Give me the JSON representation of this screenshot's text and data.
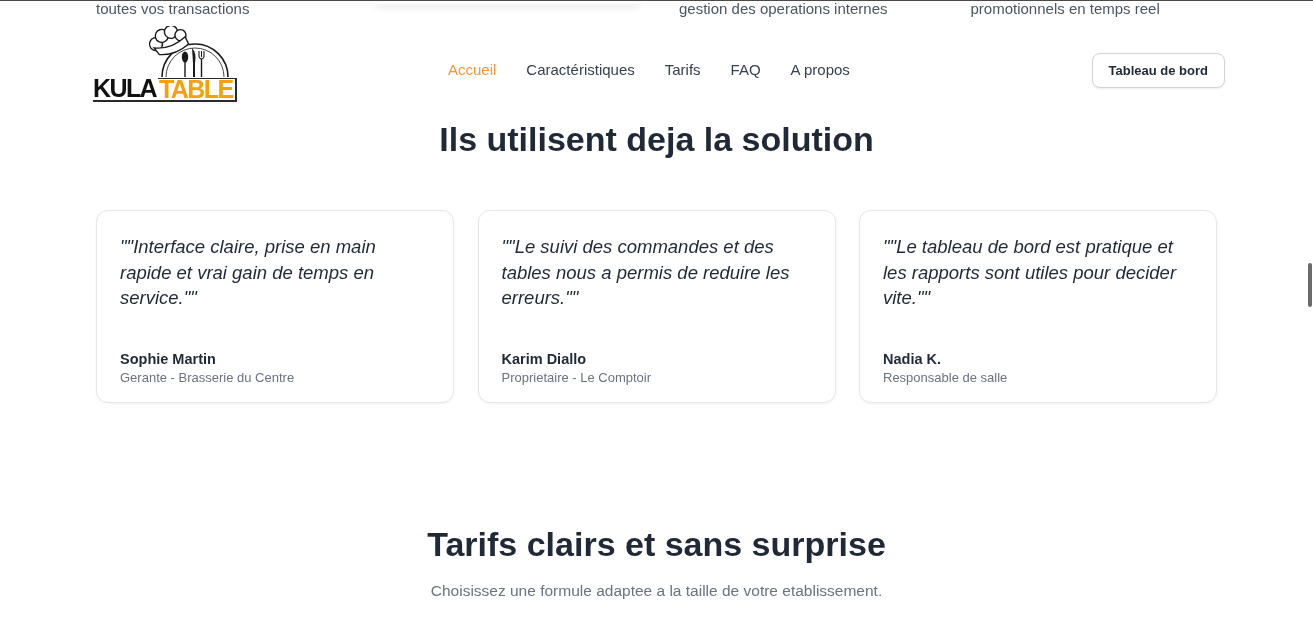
{
  "top_strip": [
    {
      "kind": "text",
      "text": "toutes vos transactions"
    },
    {
      "kind": "card"
    },
    {
      "kind": "text",
      "text": "gestion des operations internes"
    },
    {
      "kind": "text",
      "text": "promotionnels en temps reel"
    }
  ],
  "header": {
    "logo": {
      "dark": "KULA",
      "accent": "TABLE"
    },
    "nav": [
      {
        "label": "Accueil",
        "selected": true
      },
      {
        "label": "Caractéristiques",
        "selected": false
      },
      {
        "label": "Tarifs",
        "selected": false
      },
      {
        "label": "FAQ",
        "selected": false
      },
      {
        "label": "A propos",
        "selected": false
      }
    ],
    "dashboard_button": "Tableau de bord"
  },
  "testimonials": {
    "title": "Ils utilisent deja la solution",
    "cards": [
      {
        "quote": "\"\"Interface claire, prise en main rapide et vrai gain de temps en service.\"\"",
        "name": "Sophie Martin",
        "role": "Gerante - Brasserie du Centre"
      },
      {
        "quote": "\"\"Le suivi des commandes et des tables nous a permis de reduire les erreurs.\"\"",
        "name": "Karim Diallo",
        "role": "Proprietaire - Le Comptoir"
      },
      {
        "quote": "\"\"Le tableau de bord est pratique et les rapports sont utiles pour decider vite.\"\"",
        "name": "Nadia K.",
        "role": "Responsable de salle"
      }
    ]
  },
  "pricing": {
    "title": "Tarifs clairs et sans surprise",
    "subtitle": "Choisissez une formule adaptee a la taille de votre etablissement."
  }
}
